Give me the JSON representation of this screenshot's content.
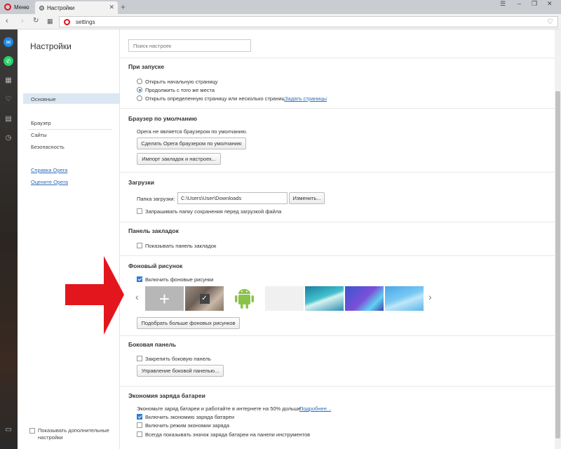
{
  "tabbar": {
    "menu_label": "Меню",
    "tab_label": "Настройки",
    "new_tab": "+",
    "close_tab": "✕"
  },
  "addressbar": {
    "url": "settings"
  },
  "nav": {
    "title": "Настройки",
    "items": [
      {
        "label": "Основные",
        "selected": true
      },
      {
        "label": "Браузер"
      },
      {
        "label": "Сайты"
      },
      {
        "label": "Безопасность"
      }
    ],
    "links": [
      "Справка Opera",
      "Оцените Opera"
    ],
    "advanced_label": "Показывать дополнительные настройки"
  },
  "main": {
    "search_placeholder": "Поиск настроек",
    "startup": {
      "title": "При запуске",
      "options": [
        "Открыть начальную страницу",
        "Продолжить с того же места",
        "Открыть определенную страницу или несколько страниц"
      ],
      "set_pages_link": "Задать страницы"
    },
    "default_browser": {
      "title": "Браузер по умолчанию",
      "status": "Opera не является браузером по умолчанию.",
      "make_default_btn": "Сделать Opera браузером по умолчанию",
      "import_btn": "Импорт закладок и настроек..."
    },
    "downloads": {
      "title": "Загрузки",
      "folder_label": "Папка загрузки:",
      "folder_value": "C:\\Users\\User\\Downloads",
      "change_btn": "Изменить...",
      "ask_label": "Запрашивать папку сохранения перед загрузкой файла"
    },
    "bookmarks_bar": {
      "title": "Панель закладок",
      "show_label": "Показывать панель закладок"
    },
    "wallpaper": {
      "title": "Фоновый рисунок",
      "enable_label": "Включить фоновые рисунки",
      "more_btn": "Подобрать больше фоновых рисунков"
    },
    "sidebar": {
      "title": "Боковая панель",
      "pin_label": "Закрепить боковую панель",
      "manage_btn": "Управление боковой панелью..."
    },
    "battery": {
      "title": "Экономия заряда батареи",
      "desc": "Экономьте заряд батареи и работайте в интернете на 50% дольше.",
      "more_link": "Подробнее...",
      "options": [
        {
          "label": "Включить экономию заряда батареи",
          "checked": true
        },
        {
          "label": "Включить режим экономии заряда",
          "checked": false
        },
        {
          "label": "Всегда показывать значок заряда батареи на панели инструментов",
          "checked": false
        }
      ]
    }
  },
  "colors": {
    "accent": "#2f7bd1",
    "link": "#2c6fba",
    "opera_red": "#e0101e",
    "annotation_arrow": "#e3161d"
  }
}
